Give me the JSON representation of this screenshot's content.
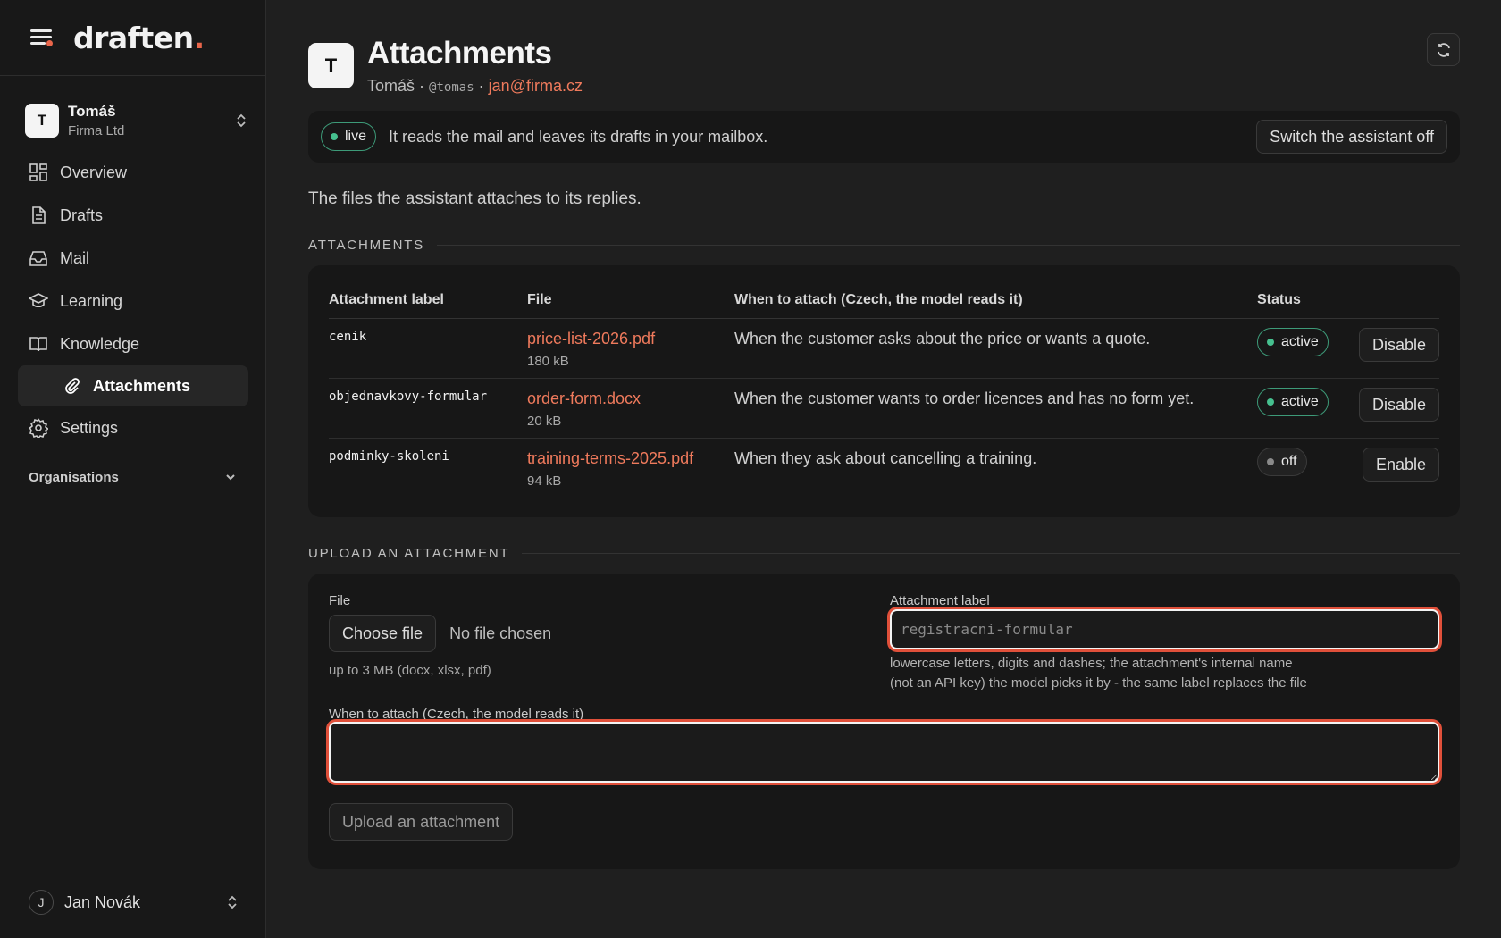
{
  "brand": {
    "name": "draften",
    "dot": "."
  },
  "org": {
    "avatar": "T",
    "name": "Tomáš",
    "sub": "Firma Ltd"
  },
  "nav": {
    "items": [
      {
        "label": "Overview",
        "icon": "grid-icon"
      },
      {
        "label": "Drafts",
        "icon": "document-icon"
      },
      {
        "label": "Mail",
        "icon": "inbox-icon"
      },
      {
        "label": "Learning",
        "icon": "graduation-cap-icon"
      },
      {
        "label": "Knowledge",
        "icon": "book-icon"
      }
    ],
    "active_sub": {
      "label": "Attachments",
      "icon": "paperclip-icon"
    },
    "settings": {
      "label": "Settings",
      "icon": "gear-icon"
    },
    "organisations_label": "Organisations"
  },
  "user": {
    "avatar": "J",
    "name": "Jan Novák"
  },
  "header": {
    "avatar": "T",
    "title": "Attachments",
    "meta_name": "Tomáš",
    "meta_sep": "·",
    "meta_handle": "@tomas",
    "meta_email": "jan@firma.cz"
  },
  "live": {
    "badge": "live",
    "text": "It reads the mail and leaves its drafts in your mailbox.",
    "switch_off_label": "Switch the assistant off"
  },
  "intro": "The files the assistant attaches to its replies.",
  "attachments_section": "ATTACHMENTS",
  "table": {
    "headers": [
      "Attachment label",
      "File",
      "When to attach (Czech, the model reads it)",
      "Status",
      ""
    ],
    "rows": [
      {
        "label": "cenik",
        "file": "price-list-2026.pdf",
        "size": "180 kB",
        "when": "When the customer asks about the price or wants a quote.",
        "status": "active",
        "action": "Disable"
      },
      {
        "label": "objednavkovy-formular",
        "file": "order-form.docx",
        "size": "20 kB",
        "when": "When the customer wants to order licences and has no form yet.",
        "status": "active",
        "action": "Disable"
      },
      {
        "label": "podminky-skoleni",
        "file": "training-terms-2025.pdf",
        "size": "94 kB",
        "when": "When they ask about cancelling a training.",
        "status": "off",
        "action": "Enable"
      }
    ]
  },
  "upload_section": "UPLOAD AN ATTACHMENT",
  "upload": {
    "file_label": "File",
    "choose_file": "Choose file",
    "no_file": "No file chosen",
    "file_hint": "up to 3 MB (docx, xlsx, pdf)",
    "label_label": "Attachment label",
    "label_placeholder": "registracni-formular",
    "label_hint_1": "lowercase letters, digits and dashes; the attachment's internal name",
    "label_hint_2": "(not an API key) the model picks it by - the same label replaces the file",
    "when_label": "When to attach (Czech, the model reads it)",
    "when_value": "",
    "submit": "Upload an attachment"
  },
  "colors": {
    "accent": "#ef7a5c",
    "active_green": "#46c08f",
    "focus_ring": "#e0503a"
  }
}
